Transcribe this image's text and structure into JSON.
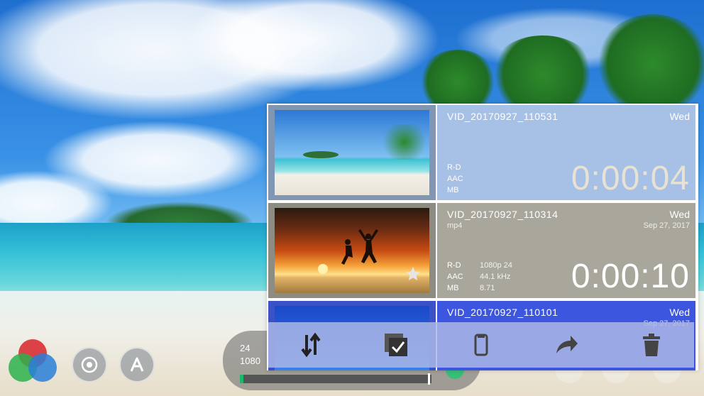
{
  "camera_controls": {
    "filter_icon": "color-filter-icon",
    "camera_switch_icon": "camera-switch-icon",
    "mode_icon": "auto-mode-icon",
    "fps_label": "24",
    "resolution_label": "1080",
    "progress_fraction": 0.02,
    "accent_color": "#1bb96b"
  },
  "gallery": {
    "items": [
      {
        "filename": "VID_20170927_110531",
        "day": "Wed",
        "subtitle": "",
        "date": "",
        "spec_labels": [
          "R-D",
          "AAC",
          "MB"
        ],
        "spec_values": [
          "",
          "",
          ""
        ],
        "duration": "0:00:04",
        "starred": false
      },
      {
        "filename": "VID_20170927_110314",
        "day": "Wed",
        "subtitle": "mp4",
        "date": "Sep 27, 2017",
        "spec_labels": [
          "R-D",
          "AAC",
          "MB"
        ],
        "spec_values": [
          "1080p 24",
          "44.1 kHz",
          "8.71"
        ],
        "duration": "0:00:10",
        "starred": true
      },
      {
        "filename": "VID_20170927_110101",
        "day": "Wed",
        "subtitle": "",
        "date": "Sep 27, 2017",
        "spec_labels": [],
        "spec_values": [],
        "duration": "",
        "starred": false
      }
    ]
  },
  "toolbar": {
    "sort_icon": "sort-arrows-icon",
    "select_icon": "select-all-checkbox-icon",
    "rename_icon": "clipboard-icon",
    "share_icon": "share-arrow-icon",
    "delete_icon": "trash-icon"
  }
}
